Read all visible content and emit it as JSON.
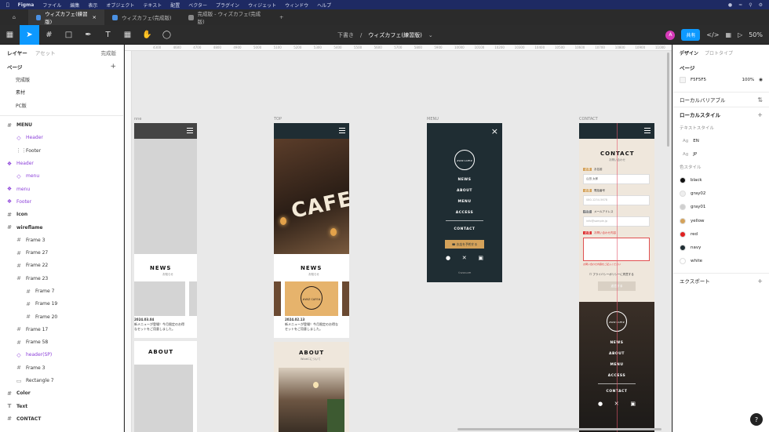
{
  "menubar": {
    "app": "Figma",
    "items": [
      "ファイル",
      "編集",
      "表示",
      "オブジェクト",
      "テキスト",
      "配置",
      "ベクター",
      "プラグイン",
      "ウィジェット",
      "ウィンドウ",
      "ヘルプ"
    ]
  },
  "tabs": [
    {
      "label": "ウィズカフェ(練習版)"
    },
    {
      "label": "ウィズカフェ(完成版)"
    },
    {
      "label": "完成版 - ウィズカフェ(完成版)"
    }
  ],
  "toolbar": {
    "breadcrumb": "下書き",
    "doc_title": "ウィズカフェ(練習版)",
    "avatar_initial": "A",
    "share_label": "共有",
    "zoom": "50%"
  },
  "left_panel": {
    "tab_layers": "レイヤー",
    "tab_assets": "アセット",
    "page_selector": "完成版",
    "pages_heading": "ページ",
    "pages": [
      "完成版",
      "素材",
      "PC版"
    ],
    "layers": [
      {
        "label": "MENU",
        "indent": 0,
        "kind": "frame",
        "bold": true
      },
      {
        "label": "Header",
        "indent": 1,
        "kind": "instance"
      },
      {
        "label": "Footer",
        "indent": 1,
        "kind": "plain"
      },
      {
        "label": "Header",
        "indent": 0,
        "kind": "component"
      },
      {
        "label": "menu",
        "indent": 1,
        "kind": "instance"
      },
      {
        "label": "menu",
        "indent": 0,
        "kind": "component"
      },
      {
        "label": "Footer",
        "indent": 0,
        "kind": "component"
      },
      {
        "label": "Icon",
        "indent": 0,
        "kind": "frame",
        "bold": true
      },
      {
        "label": "wireflame",
        "indent": 0,
        "kind": "frame",
        "bold": true
      },
      {
        "label": "Frame 3",
        "indent": 1,
        "kind": "frame"
      },
      {
        "label": "Frame 27",
        "indent": 1,
        "kind": "frame"
      },
      {
        "label": "Frame 22",
        "indent": 1,
        "kind": "frame"
      },
      {
        "label": "Frame 23",
        "indent": 1,
        "kind": "frame"
      },
      {
        "label": "Frame 7",
        "indent": 2,
        "kind": "frame"
      },
      {
        "label": "Frame 19",
        "indent": 2,
        "kind": "frame"
      },
      {
        "label": "Frame 20",
        "indent": 2,
        "kind": "frame"
      },
      {
        "label": "Frame 17",
        "indent": 1,
        "kind": "frame"
      },
      {
        "label": "Frame 58",
        "indent": 1,
        "kind": "frame"
      },
      {
        "label": "header(SP)",
        "indent": 1,
        "kind": "instance"
      },
      {
        "label": "Frame 3",
        "indent": 1,
        "kind": "frame"
      },
      {
        "label": "Rectangle 7",
        "indent": 1,
        "kind": "rect"
      },
      {
        "label": "Color",
        "indent": 0,
        "kind": "frame",
        "bold": true
      },
      {
        "label": "Text",
        "indent": 0,
        "kind": "text",
        "bold": true
      },
      {
        "label": "CONTACT",
        "indent": 0,
        "kind": "frame",
        "bold": true
      }
    ]
  },
  "ruler": [
    "4300",
    "4600",
    "4700",
    "4800",
    "4900",
    "5000",
    "5100",
    "5200",
    "5300",
    "5400",
    "5500",
    "5600",
    "5700",
    "5800",
    "5900",
    "10000",
    "10100",
    "10200",
    "10300",
    "10400",
    "10500",
    "10600",
    "10700",
    "10800",
    "10900",
    "11000"
  ],
  "canvas": {
    "frames": {
      "wire": {
        "label": "nne",
        "news_title": "NEWS",
        "news_sub": "お知らせ",
        "news_date": "2024.03.04",
        "news_text": "新メニューが登場！今月限定のお得なセットをご用意しました。",
        "about_title": "ABOUT"
      },
      "top": {
        "label": "TOP",
        "hero_text": "CAFE",
        "news_title": "NEWS",
        "news_sub": "お知らせ",
        "badge": "#WIZ CAFE#",
        "news_date": "2024.02.13",
        "news_text": "新メニューが登場！今月限定のお得なセットをご用意しました。",
        "about_title": "ABOUT",
        "about_sub": "WizaiCについて"
      },
      "menu": {
        "label": "MENU",
        "logo": "#WIZ CAFE#",
        "items": [
          "NEWS",
          "ABOUT",
          "MENU",
          "ACCESS",
          "CONTACT"
        ],
        "reserve": "お店を予約する",
        "copyright": "©WIZCAFE"
      },
      "contact": {
        "label": "CONTACT",
        "title": "CONTACT",
        "sub": "お問い合わせ",
        "fields": [
          {
            "badge": "必須",
            "label": "お名前",
            "value": "山田 太郎"
          },
          {
            "badge": "必須",
            "label": "電話番号",
            "value": "080-1234-5678"
          },
          {
            "badge": "任意",
            "label": "メールアドレス",
            "value": "info@sample.jp"
          },
          {
            "badge": "必須",
            "label": "お問い合わせ内容",
            "value": "お問い合わせ内容をご記入ください"
          }
        ],
        "privacy": "プライバシーポリシーに同意する",
        "send": "送信する",
        "footer_logo": "#WIZ CAFE#",
        "footer_items": [
          "NEWS",
          "ABOUT",
          "MENU",
          "ACCESS",
          "CONTACT"
        ]
      }
    }
  },
  "right_panel": {
    "tab_design": "デザイン",
    "tab_prototype": "プロトタイプ",
    "page_heading": "ページ",
    "page_fill": "F5F5F5",
    "page_opacity": "100%",
    "local_variables": "ローカルバリアブル",
    "local_styles": "ローカルスタイル",
    "text_styles_heading": "テキストスタイル",
    "text_styles": [
      "EN",
      "JP"
    ],
    "color_styles_heading": "色スタイル",
    "colors": [
      {
        "name": "black",
        "hex": "#111111"
      },
      {
        "name": "gray02",
        "hex": "#eeeeee"
      },
      {
        "name": "gray01",
        "hex": "#cfcfcf"
      },
      {
        "name": "yellow",
        "hex": "#d4a25a"
      },
      {
        "name": "red",
        "hex": "#e02020"
      },
      {
        "name": "navy",
        "hex": "#1f2d33"
      },
      {
        "name": "white",
        "hex": "#ffffff"
      }
    ],
    "export": "エクスポート"
  },
  "help_label": "?"
}
